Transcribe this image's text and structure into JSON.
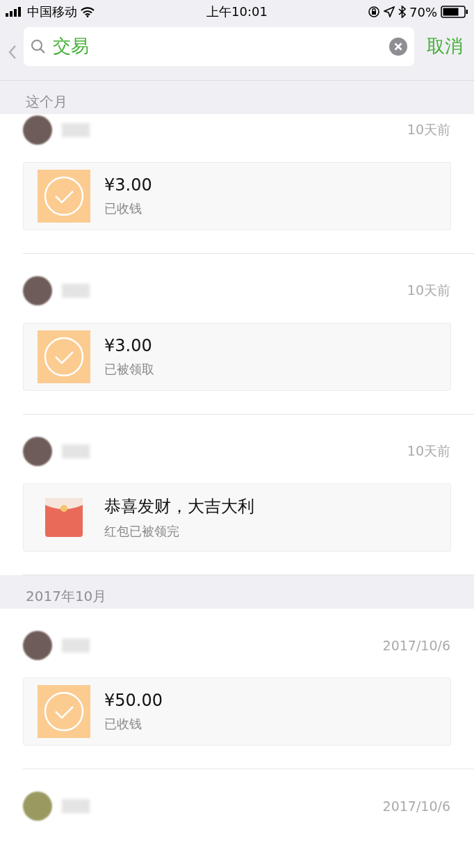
{
  "status_bar": {
    "carrier": "中国移动",
    "time": "上午10:01",
    "battery": "70%"
  },
  "search": {
    "value": "交易",
    "cancel": "取消"
  },
  "sections": [
    {
      "title": "这个月",
      "items": [
        {
          "time": "10天前",
          "card": {
            "kind": "transfer",
            "title": "¥3.00",
            "subtitle": "已收钱"
          }
        },
        {
          "time": "10天前",
          "card": {
            "kind": "transfer",
            "title": "¥3.00",
            "subtitle": "已被领取"
          }
        },
        {
          "time": "10天前",
          "card": {
            "kind": "red_packet",
            "title": "恭喜发财，大吉大利",
            "subtitle": "红包已被领完"
          }
        }
      ]
    },
    {
      "title": "2017年10月",
      "items": [
        {
          "time": "2017/10/6",
          "card": {
            "kind": "transfer",
            "title": "¥50.00",
            "subtitle": "已收钱"
          }
        },
        {
          "time": "2017/10/6"
        }
      ]
    }
  ]
}
